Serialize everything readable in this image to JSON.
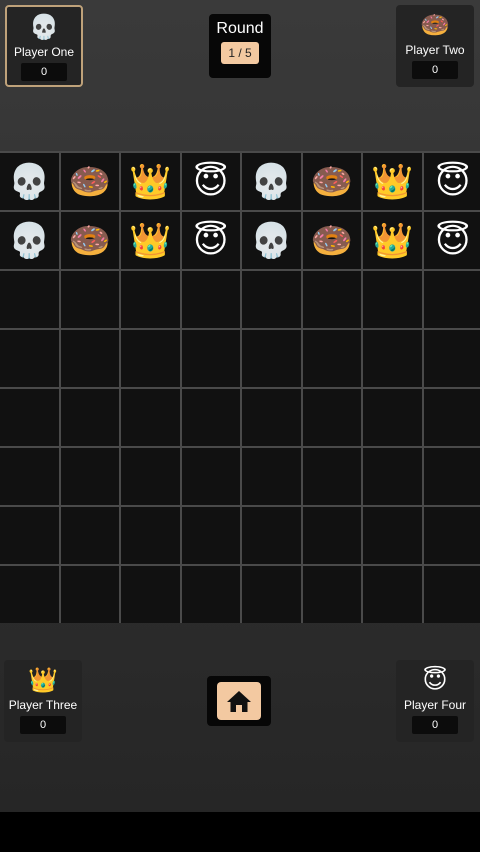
{
  "header": {
    "round_label": "Round",
    "round_value": "1 / 5"
  },
  "players": [
    {
      "name": "Player One",
      "emoji": "💀",
      "score": "0"
    },
    {
      "name": "Player Two",
      "emoji": "🍩",
      "score": "0"
    },
    {
      "name": "Player Three",
      "emoji": "👑",
      "score": "0"
    },
    {
      "name": "Player Four",
      "emoji": "😇",
      "score": "0"
    }
  ],
  "board": {
    "rows": [
      [
        "💀",
        "🍩",
        "👑",
        "😇",
        "💀",
        "🍩",
        "👑",
        "😇"
      ],
      [
        "💀",
        "🍩",
        "👑",
        "😇",
        "💀",
        "🍩",
        "👑",
        "😇"
      ],
      [
        "",
        "",
        "",
        "",
        "",
        "",
        "",
        ""
      ],
      [
        "",
        "",
        "",
        "",
        "",
        "",
        "",
        ""
      ],
      [
        "",
        "",
        "",
        "",
        "",
        "",
        "",
        ""
      ],
      [
        "",
        "",
        "",
        "",
        "",
        "",
        "",
        ""
      ],
      [
        "",
        "",
        "",
        "",
        "",
        "",
        "",
        ""
      ],
      [
        "",
        "",
        "",
        "",
        "",
        "",
        "",
        ""
      ]
    ]
  },
  "footer": {
    "home_icon": "home-icon"
  },
  "colors": {
    "accent": "#f3c9a1",
    "active_border": "#bfa27a"
  }
}
